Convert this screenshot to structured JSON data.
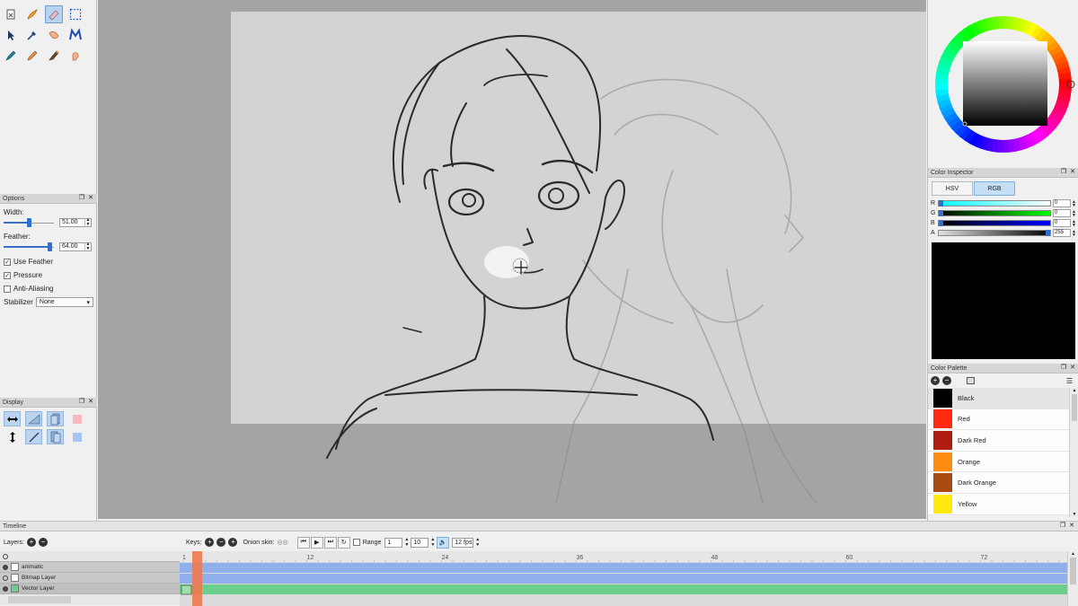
{
  "options_panel": {
    "title": "Options",
    "width_label": "Width:",
    "width_value": "51.00",
    "feather_label": "Feather:",
    "feather_value": "64.00",
    "use_feather_label": "Use Feather",
    "use_feather_checked": true,
    "pressure_label": "Pressure",
    "pressure_checked": true,
    "anti_aliasing_label": "Anti-Aliasing",
    "anti_aliasing_checked": false,
    "stabilizer_label": "Stabilizer",
    "stabilizer_value": "None"
  },
  "display_panel": {
    "title": "Display"
  },
  "tools": [
    {
      "name": "clear-icon"
    },
    {
      "name": "brush-icon"
    },
    {
      "name": "eraser-icon",
      "selected": true
    },
    {
      "name": "select-icon"
    },
    {
      "name": "pointer-icon"
    },
    {
      "name": "eyedropper-icon"
    },
    {
      "name": "smudge-icon"
    },
    {
      "name": "move-icon"
    },
    {
      "name": "pen-icon"
    },
    {
      "name": "pencil-icon"
    },
    {
      "name": "paint-bucket-icon"
    },
    {
      "name": "hand-icon"
    }
  ],
  "color_inspector": {
    "title": "Color Inspector",
    "modes": [
      "HSV",
      "RGB"
    ],
    "active_mode": "RGB",
    "channels": [
      {
        "label": "R",
        "value": "0"
      },
      {
        "label": "G",
        "value": "0"
      },
      {
        "label": "B",
        "value": "0"
      },
      {
        "label": "A",
        "value": "255"
      }
    ],
    "current_color": "#000000"
  },
  "color_palette": {
    "title": "Color Palette",
    "items": [
      {
        "name": "Black",
        "color": "#000000",
        "selected": true
      },
      {
        "name": "Red",
        "color": "#ff2b10"
      },
      {
        "name": "Dark Red",
        "color": "#b01c0f"
      },
      {
        "name": "Orange",
        "color": "#ff8c10"
      },
      {
        "name": "Dark Orange",
        "color": "#a84a12"
      },
      {
        "name": "Yellow",
        "color": "#ffe90e"
      }
    ]
  },
  "timeline": {
    "title": "Timeline",
    "layers_label": "Layers:",
    "keys_label": "Keys:",
    "onion_label": "Onion skin:",
    "range_label": "Range",
    "range_start": "1",
    "range_end": "10",
    "fps": "12 fps",
    "ruler_labels": [
      "1",
      "12",
      "24",
      "36",
      "48",
      "60",
      "72"
    ],
    "layers": [
      {
        "name": "animatic",
        "visible": true,
        "color": "#8fb0ec"
      },
      {
        "name": "Bitmap Layer",
        "visible": false,
        "color": "#8fb0ec"
      },
      {
        "name": "Vector Layer",
        "visible": true,
        "color": "#6ccf8c"
      }
    ]
  },
  "colors": {
    "accent": "#2e6fd0",
    "selected_tool_bg": "#b9d3ef",
    "playhead": "#f07850"
  }
}
